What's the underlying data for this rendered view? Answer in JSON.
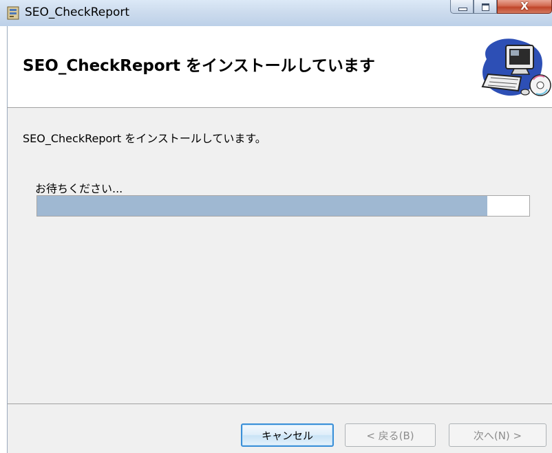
{
  "window": {
    "title": "SEO_CheckReport",
    "close_glyph": "X"
  },
  "banner": {
    "title": "SEO_CheckReport をインストールしています"
  },
  "content": {
    "message": "SEO_CheckReport をインストールしています。",
    "wait_label": "お待ちください...",
    "progress_percent": 91.5
  },
  "buttons": {
    "cancel": "キャンセル",
    "back": "< 戻る(B)",
    "next": "次へ(N) >"
  },
  "colors": {
    "progress_fill": "#9fb8d2",
    "content_bg": "#f0f0f0",
    "default_button_border": "#3a8fd8"
  }
}
